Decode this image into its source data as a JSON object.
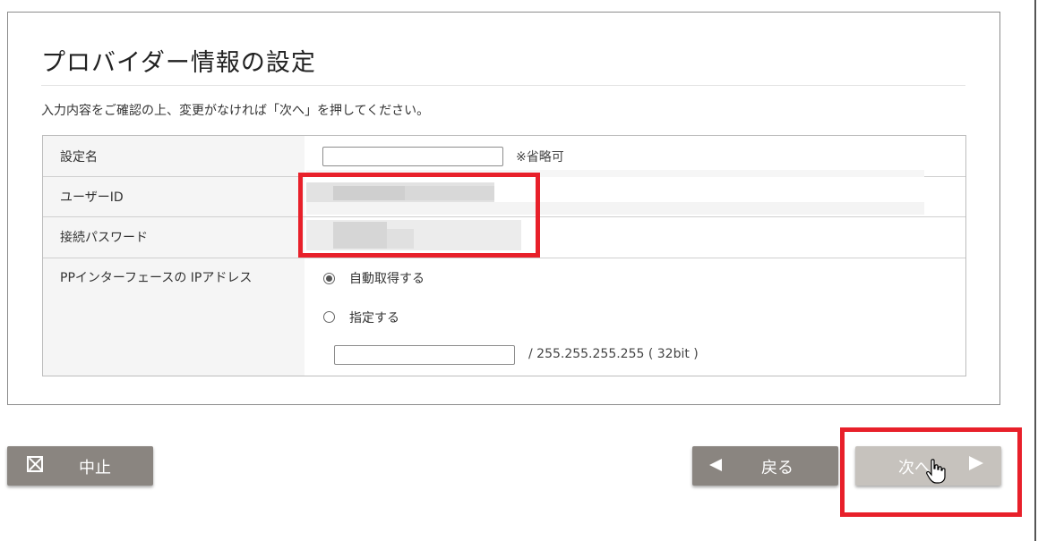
{
  "header": {
    "title": "プロバイダー情報の設定",
    "instructions": "入力内容をご確認の上、変更がなければ「次へ」を押してください。"
  },
  "form": {
    "setting_name": {
      "label": "設定名",
      "value": "",
      "note": "※省略可"
    },
    "user_id": {
      "label": "ユーザーID",
      "value_redacted": true
    },
    "password": {
      "label": "接続パスワード",
      "value_redacted": true
    },
    "ip_address": {
      "label": "PPインターフェースの IPアドレス",
      "options": [
        {
          "label": "自動取得する",
          "selected": true
        },
        {
          "label": "指定する",
          "selected": false
        }
      ],
      "address_value": "",
      "mask_text": "/ 255.255.255.255 ( 32bit )"
    }
  },
  "buttons": {
    "cancel": "中止",
    "back": "戻る",
    "next": "次へ"
  },
  "icons": {
    "cancel": "close-box-icon",
    "back": "triangle-left-icon",
    "next": "triangle-right-icon",
    "cursor": "hand-pointer-icon"
  },
  "colors": {
    "highlight": "#e8202a",
    "button": "#8a8580",
    "button_disabled": "#c6c2bd"
  }
}
